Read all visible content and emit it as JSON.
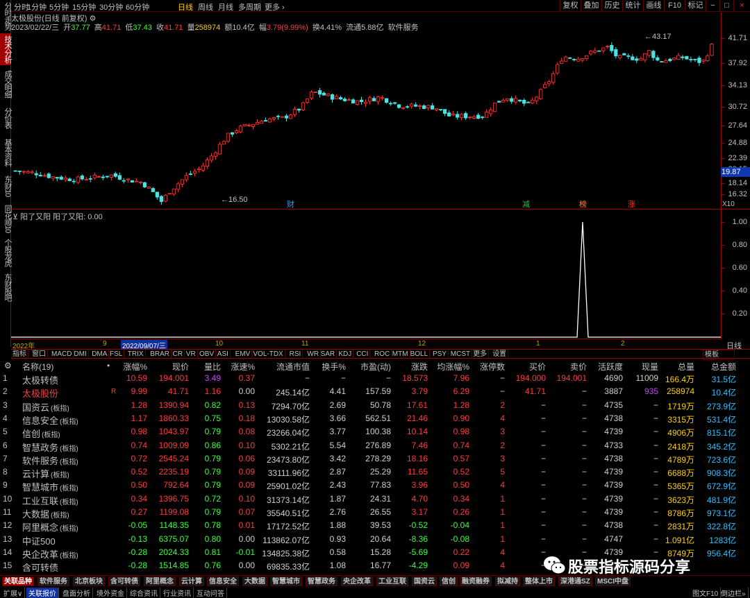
{
  "left_sidebar": [
    {
      "label": "分时走势",
      "active": false
    },
    {
      "label": "技术分析",
      "active": true
    },
    {
      "label": "成交明细",
      "active": false
    },
    {
      "label": "分价表",
      "active": false
    },
    {
      "label": "基本资料",
      "active": false
    },
    {
      "label": "东财10",
      "active": false
    },
    {
      "label": "同花顺10",
      "active": false
    },
    {
      "label": "个股龙虎",
      "active": false
    },
    {
      "label": "东财股吧",
      "active": false
    }
  ],
  "periods": [
    "分时",
    "1分钟",
    "5分钟",
    "15分钟",
    "30分钟",
    "60分钟",
    "日线",
    "周线",
    "月线",
    "多周期",
    "更多 ›"
  ],
  "selected_period": "日线",
  "toolbar_right": [
    "复权",
    "叠加",
    "历史",
    "统计",
    "画线",
    "F10",
    "标记",
    "−",
    "□",
    "×"
  ],
  "stock_title": "太极股份(日线 前复权)",
  "ohlc": {
    "date": "2023/02/22/三",
    "open_label": "开",
    "open": "37.77",
    "high_label": "高",
    "high": "41.71",
    "low_label": "低",
    "low": "37.43",
    "close_label": "收",
    "close": "41.71",
    "vol_label": "量",
    "vol": "258974",
    "amt_label": "额",
    "amt": "10.4亿",
    "chg_label": "幅",
    "chg": "3.79(9.99%)",
    "turn_label": "换",
    "turn": "4.41%",
    "float_label": "流通",
    "float": "5.88亿",
    "sector": "软件服务"
  },
  "price_axis": [
    "41.71",
    "37.92",
    "34.13",
    "30.72",
    "27.64",
    "24.88",
    "22.39",
    "20.15",
    "18.14",
    "16.32"
  ],
  "current_price_tag": "19.87",
  "axis_unit": "X10",
  "high_marker": "43.17",
  "low_marker": "16.50",
  "event_labels": [
    {
      "text": "财",
      "color": "#30a0ff"
    },
    {
      "text": "减",
      "color": "#30c030"
    },
    {
      "text": "榜",
      "color": "#ff8030"
    },
    {
      "text": "涨",
      "color": "#ff3030"
    }
  ],
  "indicator": {
    "title": "阳了又阳 阳了又阳: 0.00",
    "axis": [
      "1.00",
      "0.80",
      "0.60",
      "0.40",
      "0.20"
    ]
  },
  "date_axis": [
    {
      "text": "2022年",
      "hl": false
    },
    {
      "text": "9",
      "hl": false
    },
    {
      "text": "2022/09/07/三",
      "hl": true
    },
    {
      "text": "10",
      "hl": false
    },
    {
      "text": "11",
      "hl": false
    },
    {
      "text": "12",
      "hl": false
    },
    {
      "text": "1",
      "hl": false
    },
    {
      "text": "2",
      "hl": false
    }
  ],
  "day_label": "日线",
  "indicator_tabs": [
    "指标",
    "窗口",
    "MACD",
    "DMI",
    "DMA",
    "FSL",
    "TRIX",
    "BRAR",
    "CR",
    "VR",
    "OBV",
    "ASI",
    "EMV",
    "VOL-TDX",
    "RSI",
    "WR",
    "SAR",
    "KDJ",
    "CCI",
    "ROC",
    "MTM",
    "BOLL",
    "PSY",
    "MCST",
    "更多",
    "设置"
  ],
  "template_label": "模板",
  "table": {
    "headers": [
      "名称(19)",
      "•",
      "涨幅%",
      "现价",
      "量比",
      "涨速%",
      "流通市值",
      "换手%",
      "市盈(动)",
      "涨跌",
      "均涨幅%",
      "涨停数",
      "买价",
      "卖价",
      "活跃度",
      "现量",
      "总量",
      "总金额"
    ],
    "rows": [
      {
        "idx": "1",
        "name": "太极转债",
        "tag": "",
        "mark": "",
        "chg": "10.59",
        "price": "194.001",
        "vr": "3.49",
        "spd": "0.37",
        "mcap": "−",
        "turn": "−",
        "pe": "−",
        "diff": "18.573",
        "avg": "7.96",
        "lim": "−",
        "bid": "194.000",
        "ask": "194.001",
        "act": "4690",
        "cur": "11009",
        "vol": "166.4万",
        "amt": "31.5亿",
        "name_color": "w",
        "c1": "r",
        "c2": "r",
        "vrc": "p",
        "spc": "r",
        "dfc": "r",
        "avc": "r",
        "limc": "w",
        "bidc": "r",
        "askc": "r",
        "curc": "w"
      },
      {
        "idx": "2",
        "name": "太极股份",
        "tag": "",
        "mark": "R",
        "chg": "9.99",
        "price": "41.71",
        "vr": "1.16",
        "spd": "0.00",
        "mcap": "245.14亿",
        "turn": "4.41",
        "pe": "157.59",
        "diff": "3.79",
        "avg": "6.29",
        "lim": "−",
        "bid": "41.71",
        "ask": "−",
        "act": "3887",
        "cur": "935",
        "vol": "258974",
        "amt": "10.4亿",
        "name_color": "r",
        "c1": "r",
        "c2": "r",
        "vrc": "r",
        "spc": "w",
        "dfc": "r",
        "avc": "r",
        "limc": "w",
        "bidc": "r",
        "askc": "w",
        "curc": "m"
      },
      {
        "idx": "3",
        "name": "国资云",
        "tag": "(板指)",
        "mark": "",
        "chg": "1.28",
        "price": "1390.94",
        "vr": "0.82",
        "spd": "0.13",
        "mcap": "7294.70亿",
        "turn": "2.69",
        "pe": "50.78",
        "diff": "17.61",
        "avg": "1.28",
        "lim": "2",
        "bid": "−",
        "ask": "−",
        "act": "4735",
        "cur": "−",
        "vol": "1719万",
        "amt": "273.9亿",
        "name_color": "w",
        "c1": "r",
        "c2": "r",
        "vrc": "g",
        "spc": "r",
        "dfc": "r",
        "avc": "r",
        "limc": "r",
        "bidc": "w",
        "askc": "w",
        "curc": "w"
      },
      {
        "idx": "4",
        "name": "信息安全",
        "tag": "(板指)",
        "mark": "",
        "chg": "1.17",
        "price": "1860.33",
        "vr": "0.75",
        "spd": "0.18",
        "mcap": "13030.58亿",
        "turn": "3.66",
        "pe": "562.51",
        "diff": "21.46",
        "avg": "0.90",
        "lim": "4",
        "bid": "−",
        "ask": "−",
        "act": "4738",
        "cur": "−",
        "vol": "3315万",
        "amt": "531.4亿",
        "name_color": "w",
        "c1": "r",
        "c2": "r",
        "vrc": "g",
        "spc": "r",
        "dfc": "r",
        "avc": "r",
        "limc": "r",
        "bidc": "w",
        "askc": "w",
        "curc": "w"
      },
      {
        "idx": "5",
        "name": "信创",
        "tag": "(板指)",
        "mark": "",
        "chg": "0.98",
        "price": "1043.97",
        "vr": "0.79",
        "spd": "0.08",
        "mcap": "23266.04亿",
        "turn": "3.77",
        "pe": "100.38",
        "diff": "10.14",
        "avg": "0.98",
        "lim": "3",
        "bid": "−",
        "ask": "−",
        "act": "4739",
        "cur": "−",
        "vol": "4906万",
        "amt": "815.1亿",
        "name_color": "w",
        "c1": "r",
        "c2": "r",
        "vrc": "g",
        "spc": "r",
        "dfc": "r",
        "avc": "r",
        "limc": "r",
        "bidc": "w",
        "askc": "w",
        "curc": "w"
      },
      {
        "idx": "6",
        "name": "智慧政务",
        "tag": "(板指)",
        "mark": "",
        "chg": "0.74",
        "price": "1009.09",
        "vr": "0.86",
        "spd": "0.10",
        "mcap": "5302.21亿",
        "turn": "5.54",
        "pe": "276.89",
        "diff": "7.46",
        "avg": "0.74",
        "lim": "2",
        "bid": "−",
        "ask": "−",
        "act": "4733",
        "cur": "−",
        "vol": "2418万",
        "amt": "345.2亿",
        "name_color": "w",
        "c1": "r",
        "c2": "r",
        "vrc": "g",
        "spc": "r",
        "dfc": "r",
        "avc": "r",
        "limc": "r",
        "bidc": "w",
        "askc": "w",
        "curc": "w"
      },
      {
        "idx": "7",
        "name": "软件服务",
        "tag": "(板指)",
        "mark": "",
        "chg": "0.72",
        "price": "2545.24",
        "vr": "0.79",
        "spd": "0.06",
        "mcap": "23473.80亿",
        "turn": "3.42",
        "pe": "278.29",
        "diff": "18.16",
        "avg": "0.57",
        "lim": "3",
        "bid": "−",
        "ask": "−",
        "act": "4738",
        "cur": "−",
        "vol": "4789万",
        "amt": "723.6亿",
        "name_color": "w",
        "c1": "r",
        "c2": "r",
        "vrc": "g",
        "spc": "r",
        "dfc": "r",
        "avc": "r",
        "limc": "r",
        "bidc": "w",
        "askc": "w",
        "curc": "w"
      },
      {
        "idx": "8",
        "name": "云计算",
        "tag": "(板指)",
        "mark": "",
        "chg": "0.52",
        "price": "2235.19",
        "vr": "0.79",
        "spd": "0.09",
        "mcap": "33111.96亿",
        "turn": "2.87",
        "pe": "25.29",
        "diff": "11.65",
        "avg": "0.52",
        "lim": "5",
        "bid": "−",
        "ask": "−",
        "act": "4739",
        "cur": "−",
        "vol": "6688万",
        "amt": "908.3亿",
        "name_color": "w",
        "c1": "r",
        "c2": "r",
        "vrc": "g",
        "spc": "r",
        "dfc": "r",
        "avc": "r",
        "limc": "r",
        "bidc": "w",
        "askc": "w",
        "curc": "w"
      },
      {
        "idx": "9",
        "name": "智慧城市",
        "tag": "(板指)",
        "mark": "",
        "chg": "0.50",
        "price": "792.64",
        "vr": "0.79",
        "spd": "0.09",
        "mcap": "25901.02亿",
        "turn": "2.43",
        "pe": "77.83",
        "diff": "3.96",
        "avg": "0.50",
        "lim": "4",
        "bid": "−",
        "ask": "−",
        "act": "4739",
        "cur": "−",
        "vol": "5365万",
        "amt": "672.9亿",
        "name_color": "w",
        "c1": "r",
        "c2": "r",
        "vrc": "g",
        "spc": "r",
        "dfc": "r",
        "avc": "r",
        "limc": "r",
        "bidc": "w",
        "askc": "w",
        "curc": "w"
      },
      {
        "idx": "10",
        "name": "工业互联",
        "tag": "(板指)",
        "mark": "",
        "chg": "0.34",
        "price": "1396.75",
        "vr": "0.72",
        "spd": "0.10",
        "mcap": "31373.14亿",
        "turn": "1.87",
        "pe": "24.31",
        "diff": "4.70",
        "avg": "0.34",
        "lim": "1",
        "bid": "−",
        "ask": "−",
        "act": "4739",
        "cur": "−",
        "vol": "3623万",
        "amt": "481.9亿",
        "name_color": "w",
        "c1": "r",
        "c2": "r",
        "vrc": "g",
        "spc": "r",
        "dfc": "r",
        "avc": "r",
        "limc": "r",
        "bidc": "w",
        "askc": "w",
        "curc": "w"
      },
      {
        "idx": "11",
        "name": "大数据",
        "tag": "(板指)",
        "mark": "",
        "chg": "0.27",
        "price": "1199.08",
        "vr": "0.79",
        "spd": "0.07",
        "mcap": "35540.51亿",
        "turn": "2.76",
        "pe": "26.55",
        "diff": "3.17",
        "avg": "0.26",
        "lim": "1",
        "bid": "−",
        "ask": "−",
        "act": "4739",
        "cur": "−",
        "vol": "8786万",
        "amt": "973.1亿",
        "name_color": "w",
        "c1": "r",
        "c2": "r",
        "vrc": "g",
        "spc": "r",
        "dfc": "r",
        "avc": "r",
        "limc": "r",
        "bidc": "w",
        "askc": "w",
        "curc": "w"
      },
      {
        "idx": "12",
        "name": "阿里概念",
        "tag": "(板指)",
        "mark": "",
        "chg": "-0.05",
        "price": "1148.35",
        "vr": "0.78",
        "spd": "0.01",
        "mcap": "17172.52亿",
        "turn": "1.88",
        "pe": "39.53",
        "diff": "-0.52",
        "avg": "-0.04",
        "lim": "1",
        "bid": "−",
        "ask": "−",
        "act": "4738",
        "cur": "−",
        "vol": "2831万",
        "amt": "322.8亿",
        "name_color": "w",
        "c1": "g",
        "c2": "g",
        "vrc": "g",
        "spc": "r",
        "dfc": "g",
        "avc": "g",
        "limc": "r",
        "bidc": "w",
        "askc": "w",
        "curc": "w"
      },
      {
        "idx": "13",
        "name": "中证500",
        "tag": "",
        "mark": "",
        "chg": "-0.13",
        "price": "6375.07",
        "vr": "0.80",
        "spd": "0.00",
        "mcap": "113862.07亿",
        "turn": "0.93",
        "pe": "20.64",
        "diff": "-8.36",
        "avg": "-0.08",
        "lim": "1",
        "bid": "−",
        "ask": "−",
        "act": "4747",
        "cur": "−",
        "vol": "1.091亿",
        "amt": "1283亿",
        "name_color": "w",
        "c1": "g",
        "c2": "g",
        "vrc": "g",
        "spc": "w",
        "dfc": "g",
        "avc": "g",
        "limc": "r",
        "bidc": "w",
        "askc": "w",
        "curc": "w"
      },
      {
        "idx": "14",
        "name": "央企改革",
        "tag": "(板指)",
        "mark": "",
        "chg": "-0.28",
        "price": "2024.33",
        "vr": "0.81",
        "spd": "-0.01",
        "mcap": "134825.38亿",
        "turn": "0.58",
        "pe": "15.28",
        "diff": "-5.69",
        "avg": "0.22",
        "lim": "4",
        "bid": "−",
        "ask": "−",
        "act": "4739",
        "cur": "−",
        "vol": "8749万",
        "amt": "956.4亿",
        "name_color": "w",
        "c1": "g",
        "c2": "g",
        "vrc": "g",
        "spc": "g",
        "dfc": "g",
        "avc": "r",
        "limc": "r",
        "bidc": "w",
        "askc": "w",
        "curc": "w"
      },
      {
        "idx": "15",
        "name": "含可转债",
        "tag": "",
        "mark": "",
        "chg": "-0.28",
        "price": "1514.85",
        "vr": "0.76",
        "spd": "0.00",
        "mcap": "69835.33亿",
        "turn": "1.08",
        "pe": "16.77",
        "diff": "-4.29",
        "avg": "0.09",
        "lim": "4",
        "bid": "−",
        "ask": "−",
        "act": "4739",
        "cur": "−",
        "vol": "",
        "amt": "",
        "name_color": "w",
        "c1": "g",
        "c2": "g",
        "vrc": "g",
        "spc": "w",
        "dfc": "g",
        "avc": "r",
        "limc": "r",
        "bidc": "w",
        "askc": "w",
        "curc": "w"
      }
    ]
  },
  "sector_tabs": [
    "关联品种",
    "软件服务",
    "北京板块",
    "含可转债",
    "阿里概念",
    "云计算",
    "信息安全",
    "大数据",
    "智慧城市",
    "智慧政务",
    "央企改革",
    "工业互联",
    "国资云",
    "信创",
    "融资融券",
    "拟减持",
    "整体上市",
    "深港通SZ",
    "MSCI中盘"
  ],
  "bottom_tabs": [
    "扩展∨",
    "关联报价",
    "盘面分析",
    "境外资金",
    "综合资讯",
    "行业资讯",
    "互动问答"
  ],
  "bottom_right": [
    "图文F10",
    "倒边栏»"
  ],
  "watermark": "股票指标源码分享"
}
